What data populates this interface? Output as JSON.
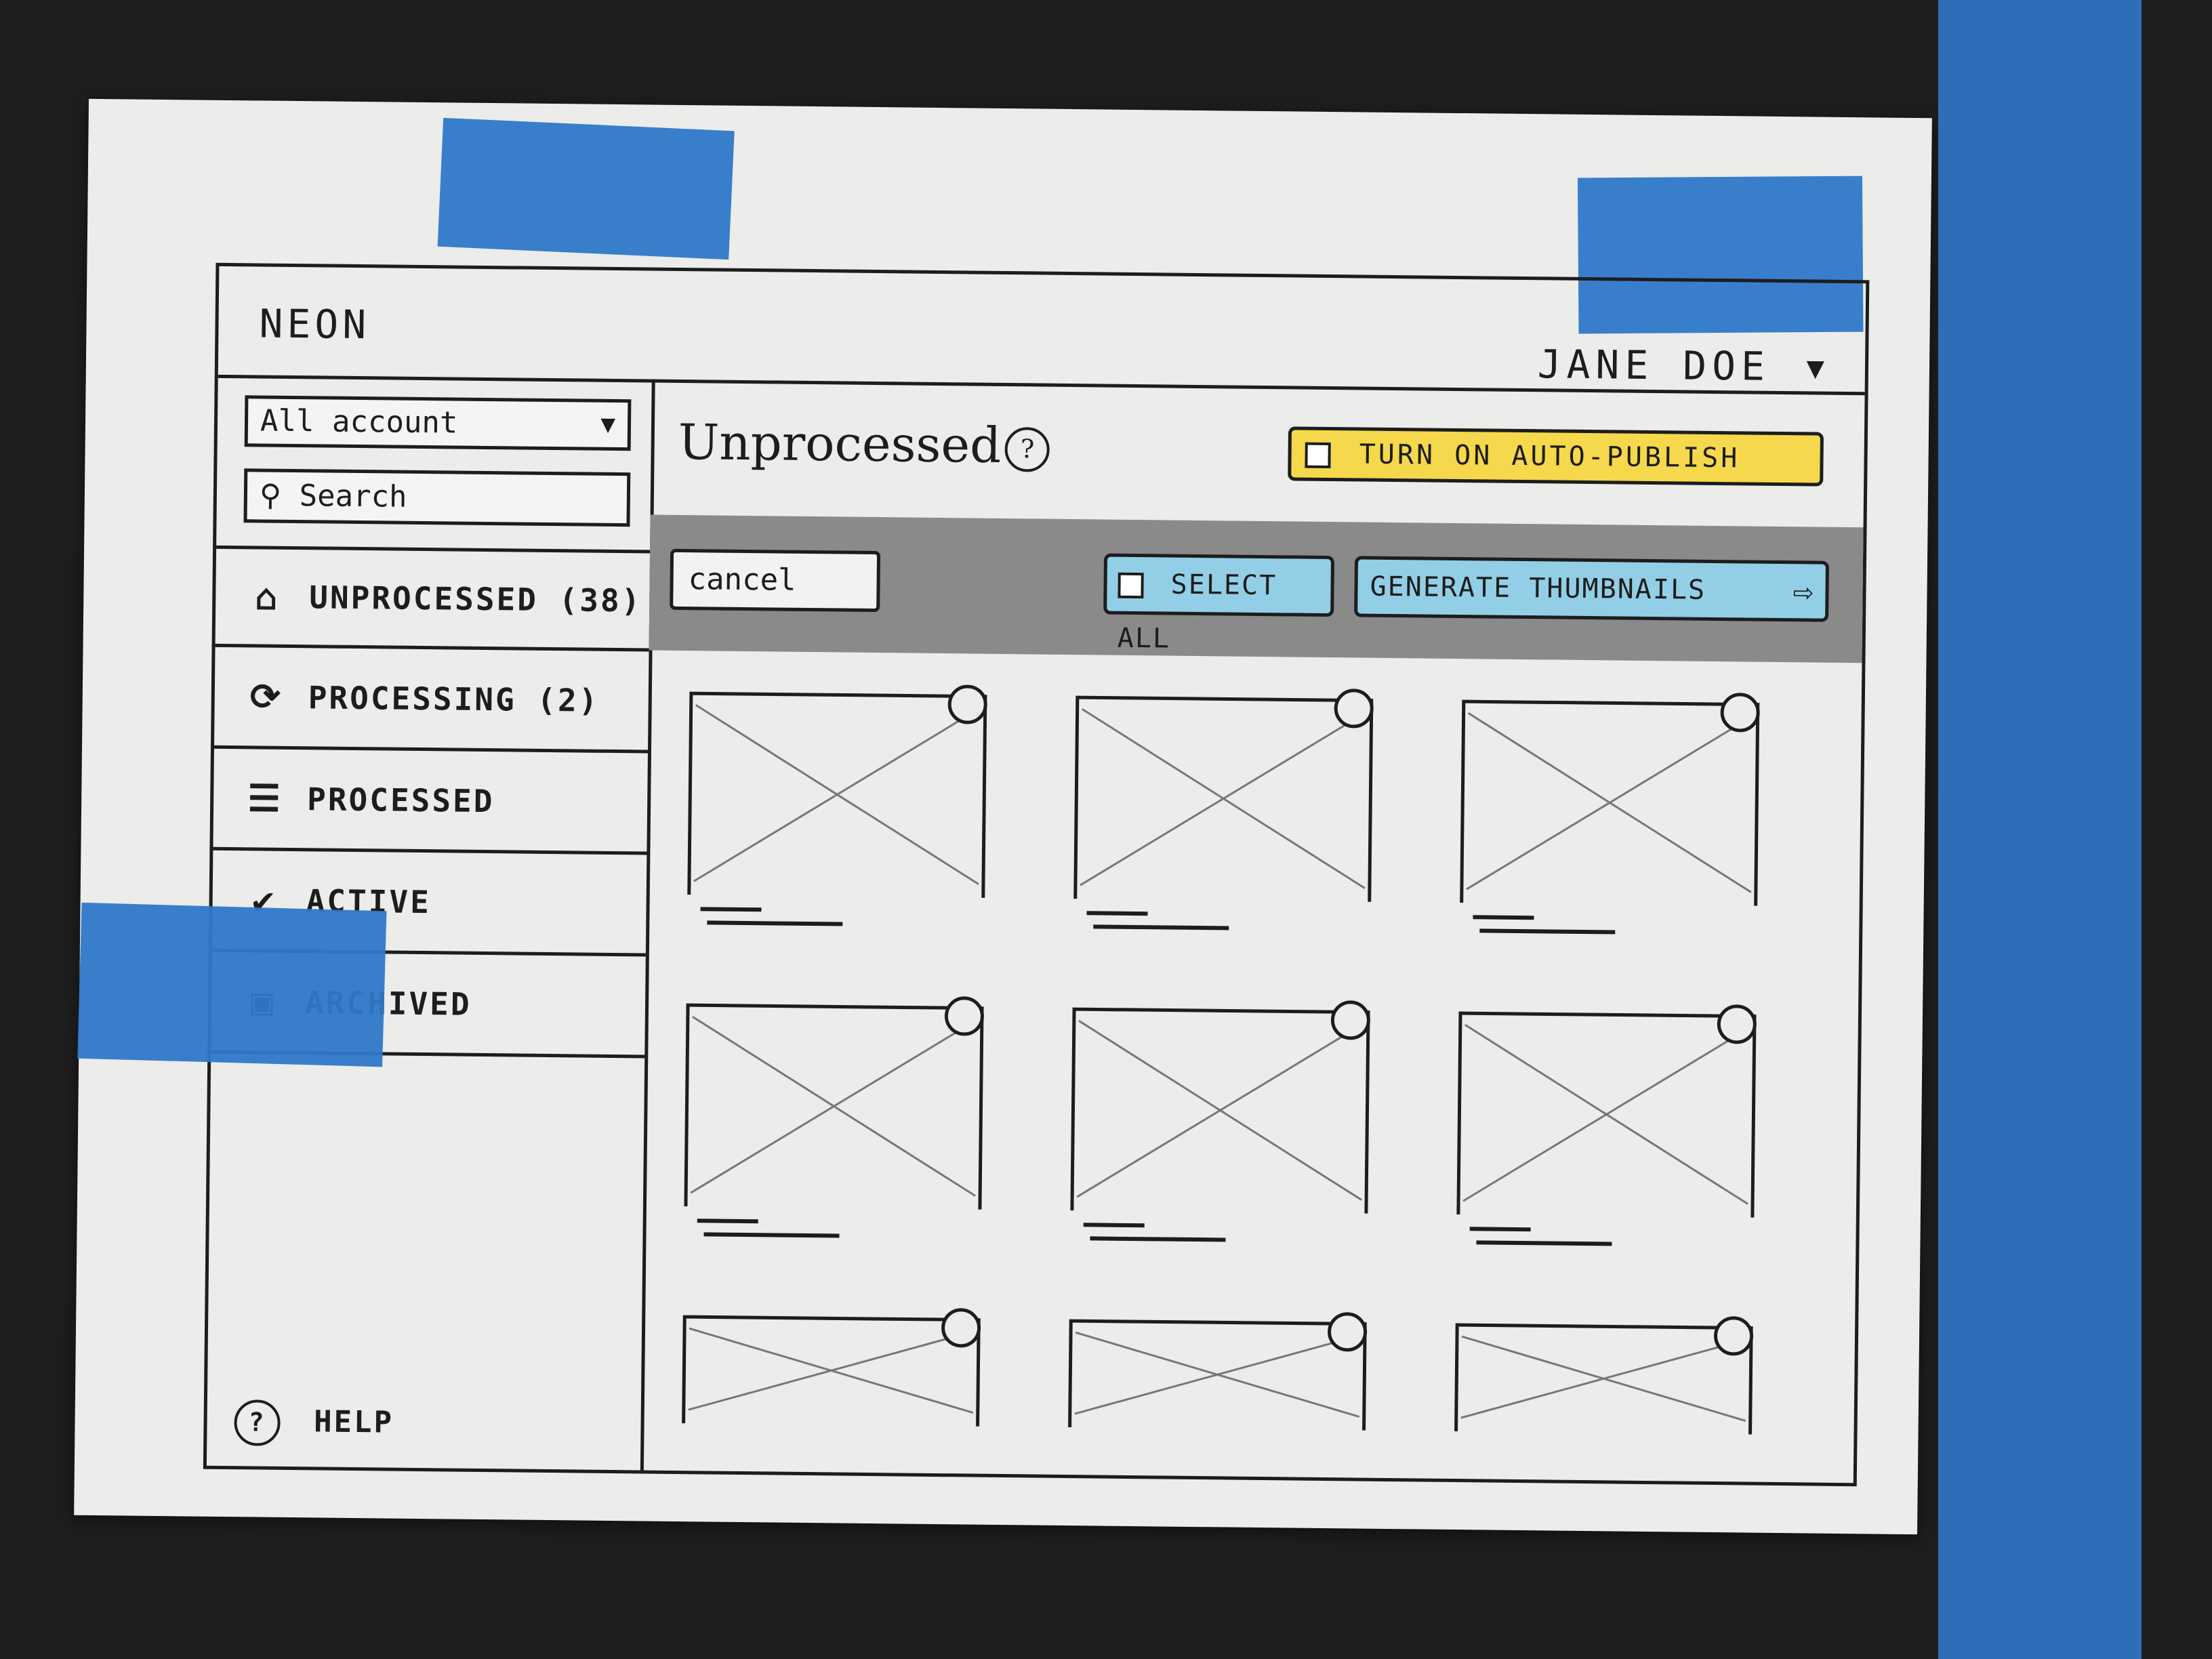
{
  "app": {
    "logo": "NEON",
    "user_name": "JANE DOE",
    "user_caret": "▼"
  },
  "sidebar": {
    "account_select": {
      "value": "All account",
      "caret": "▼"
    },
    "search": {
      "placeholder": "Search",
      "icon": "search-icon"
    },
    "items": [
      {
        "label": "UNPROCESSED (38)",
        "icon": "inbox-icon",
        "glyph": "⌂"
      },
      {
        "label": "PROCESSING (2)",
        "icon": "refresh-icon",
        "glyph": "⟳"
      },
      {
        "label": "PROCESSED",
        "icon": "stack-icon",
        "glyph": "☰"
      },
      {
        "label": "ACTIVE",
        "icon": "check-circle-icon",
        "glyph": "✔"
      },
      {
        "label": "ARCHIVED",
        "icon": "archive-icon",
        "glyph": "▣"
      }
    ],
    "help": {
      "label": "HELP",
      "icon": "help-icon",
      "glyph": "?"
    }
  },
  "main": {
    "title": "Unprocessed",
    "title_help_glyph": "?",
    "auto_publish_label": "TURN ON AUTO-PUBLISH",
    "actions": {
      "cancel_label": "cancel",
      "select_all_label": "SELECT ALL",
      "generate_label": "GENERATE THUMBNAILS",
      "generate_arrow": "⇨"
    },
    "thumbnails_count": 9
  },
  "colors": {
    "paper": "#ececea",
    "ink": "#1d1d1d",
    "highlight_yellow": "#f5d84b",
    "highlight_blue": "#92cfe6",
    "tape_blue": "#2f78c9",
    "action_bar_gray": "#8a8a8a"
  }
}
